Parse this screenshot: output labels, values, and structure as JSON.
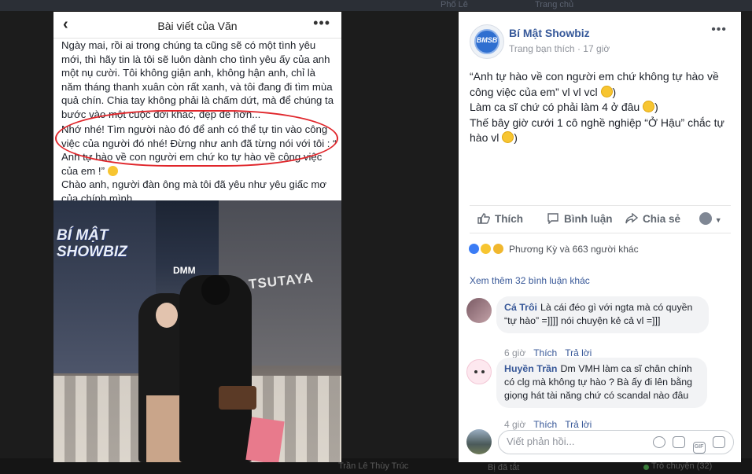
{
  "background": {
    "top_left_text": "Phố Lê",
    "top_right_text": "Trang chủ",
    "bottom_text_1": "Trần Lê Thùy Trúc",
    "bottom_text_2": "Bị đã tắt",
    "bottom_text_3": "Trò chuyện (32)"
  },
  "phone": {
    "title": "Bài viết của Văn",
    "back_icon": "‹",
    "more_icon": "•••",
    "paragraphs": [
      "Ngày mai, rồi ai trong chúng ta cũng sẽ có một tình yêu mới, thì hãy tin là tôi sẽ luôn dành cho tình yêu ấy của anh một nụ cười. Tôi không giận anh, không hận anh, chỉ là năm tháng thanh xuân còn rất xanh, và tôi đang đi tìm mùa quả chín. Chia tay không phải là chấm dứt, mà để chúng ta bước vào một cuộc đời khác, đẹp đẽ hơn...",
      "Nhớ nhé! Tìm người nào đó để anh có thể tự tin vào công việc của người đó nhé! Đừng như anh đã từng nói với tôi : “ Anh tự hào về con người em chứ ko tự hào về công việc của em !”",
      "Chào anh, người đàn ông mà tôi đã yêu như yêu giấc mơ của chính mình..."
    ],
    "photo": {
      "watermark_line1": "BÍ MẬT",
      "watermark_line2": "SHOWBIZ",
      "sign_1": "TSUTAYA",
      "sign_2": "DMM"
    }
  },
  "post": {
    "page_name": "Bí Mật Showbiz",
    "avatar_text": "BMSB",
    "meta_audience": "Trang bạn thích",
    "meta_sep": "·",
    "meta_time": "17 giờ",
    "more_icon": "•••",
    "lines": [
      "“Anh tự hào về con người em chứ không tự hào về công việc của em” vl vl vcl",
      "Làm ca sĩ chứ có phải làm 4 ở đâu",
      "Thế bây giờ cưới 1 cô nghề nghiệp “Ở Hậu” chắc tự hào vl"
    ],
    "actions": {
      "like": "Thích",
      "comment": "Bình luận",
      "share": "Chia sẻ"
    },
    "reactions_text": "Phương Kỳ và 663 người khác",
    "more_comments": "Xem thêm 32 bình luận khác"
  },
  "comments": [
    {
      "author": "Cá Trôi",
      "text": "Là cái đéo gì với ngta mà có quyền “tự hào” =]]]] nói chuyện kẻ cả vl =]]]",
      "time": "6 giờ",
      "like": "Thích",
      "reply": "Trả lời"
    },
    {
      "author": "Huyền Trần",
      "text": "Dm VMH làm ca sĩ chân chính có clg mà không tự hào ? Bà ấy đi lên bằng giọng hát tài năng chứ có scandal nào đâu",
      "time": "4 giờ",
      "like": "Thích",
      "reply": "Trả lời"
    }
  ],
  "reply_box": {
    "placeholder": "Viết phản hồi...",
    "icons": [
      "emoji-icon",
      "camera-icon",
      "gif-icon",
      "sticker-icon"
    ]
  },
  "colors": {
    "link": "#385898",
    "circle": "#e0262b"
  }
}
